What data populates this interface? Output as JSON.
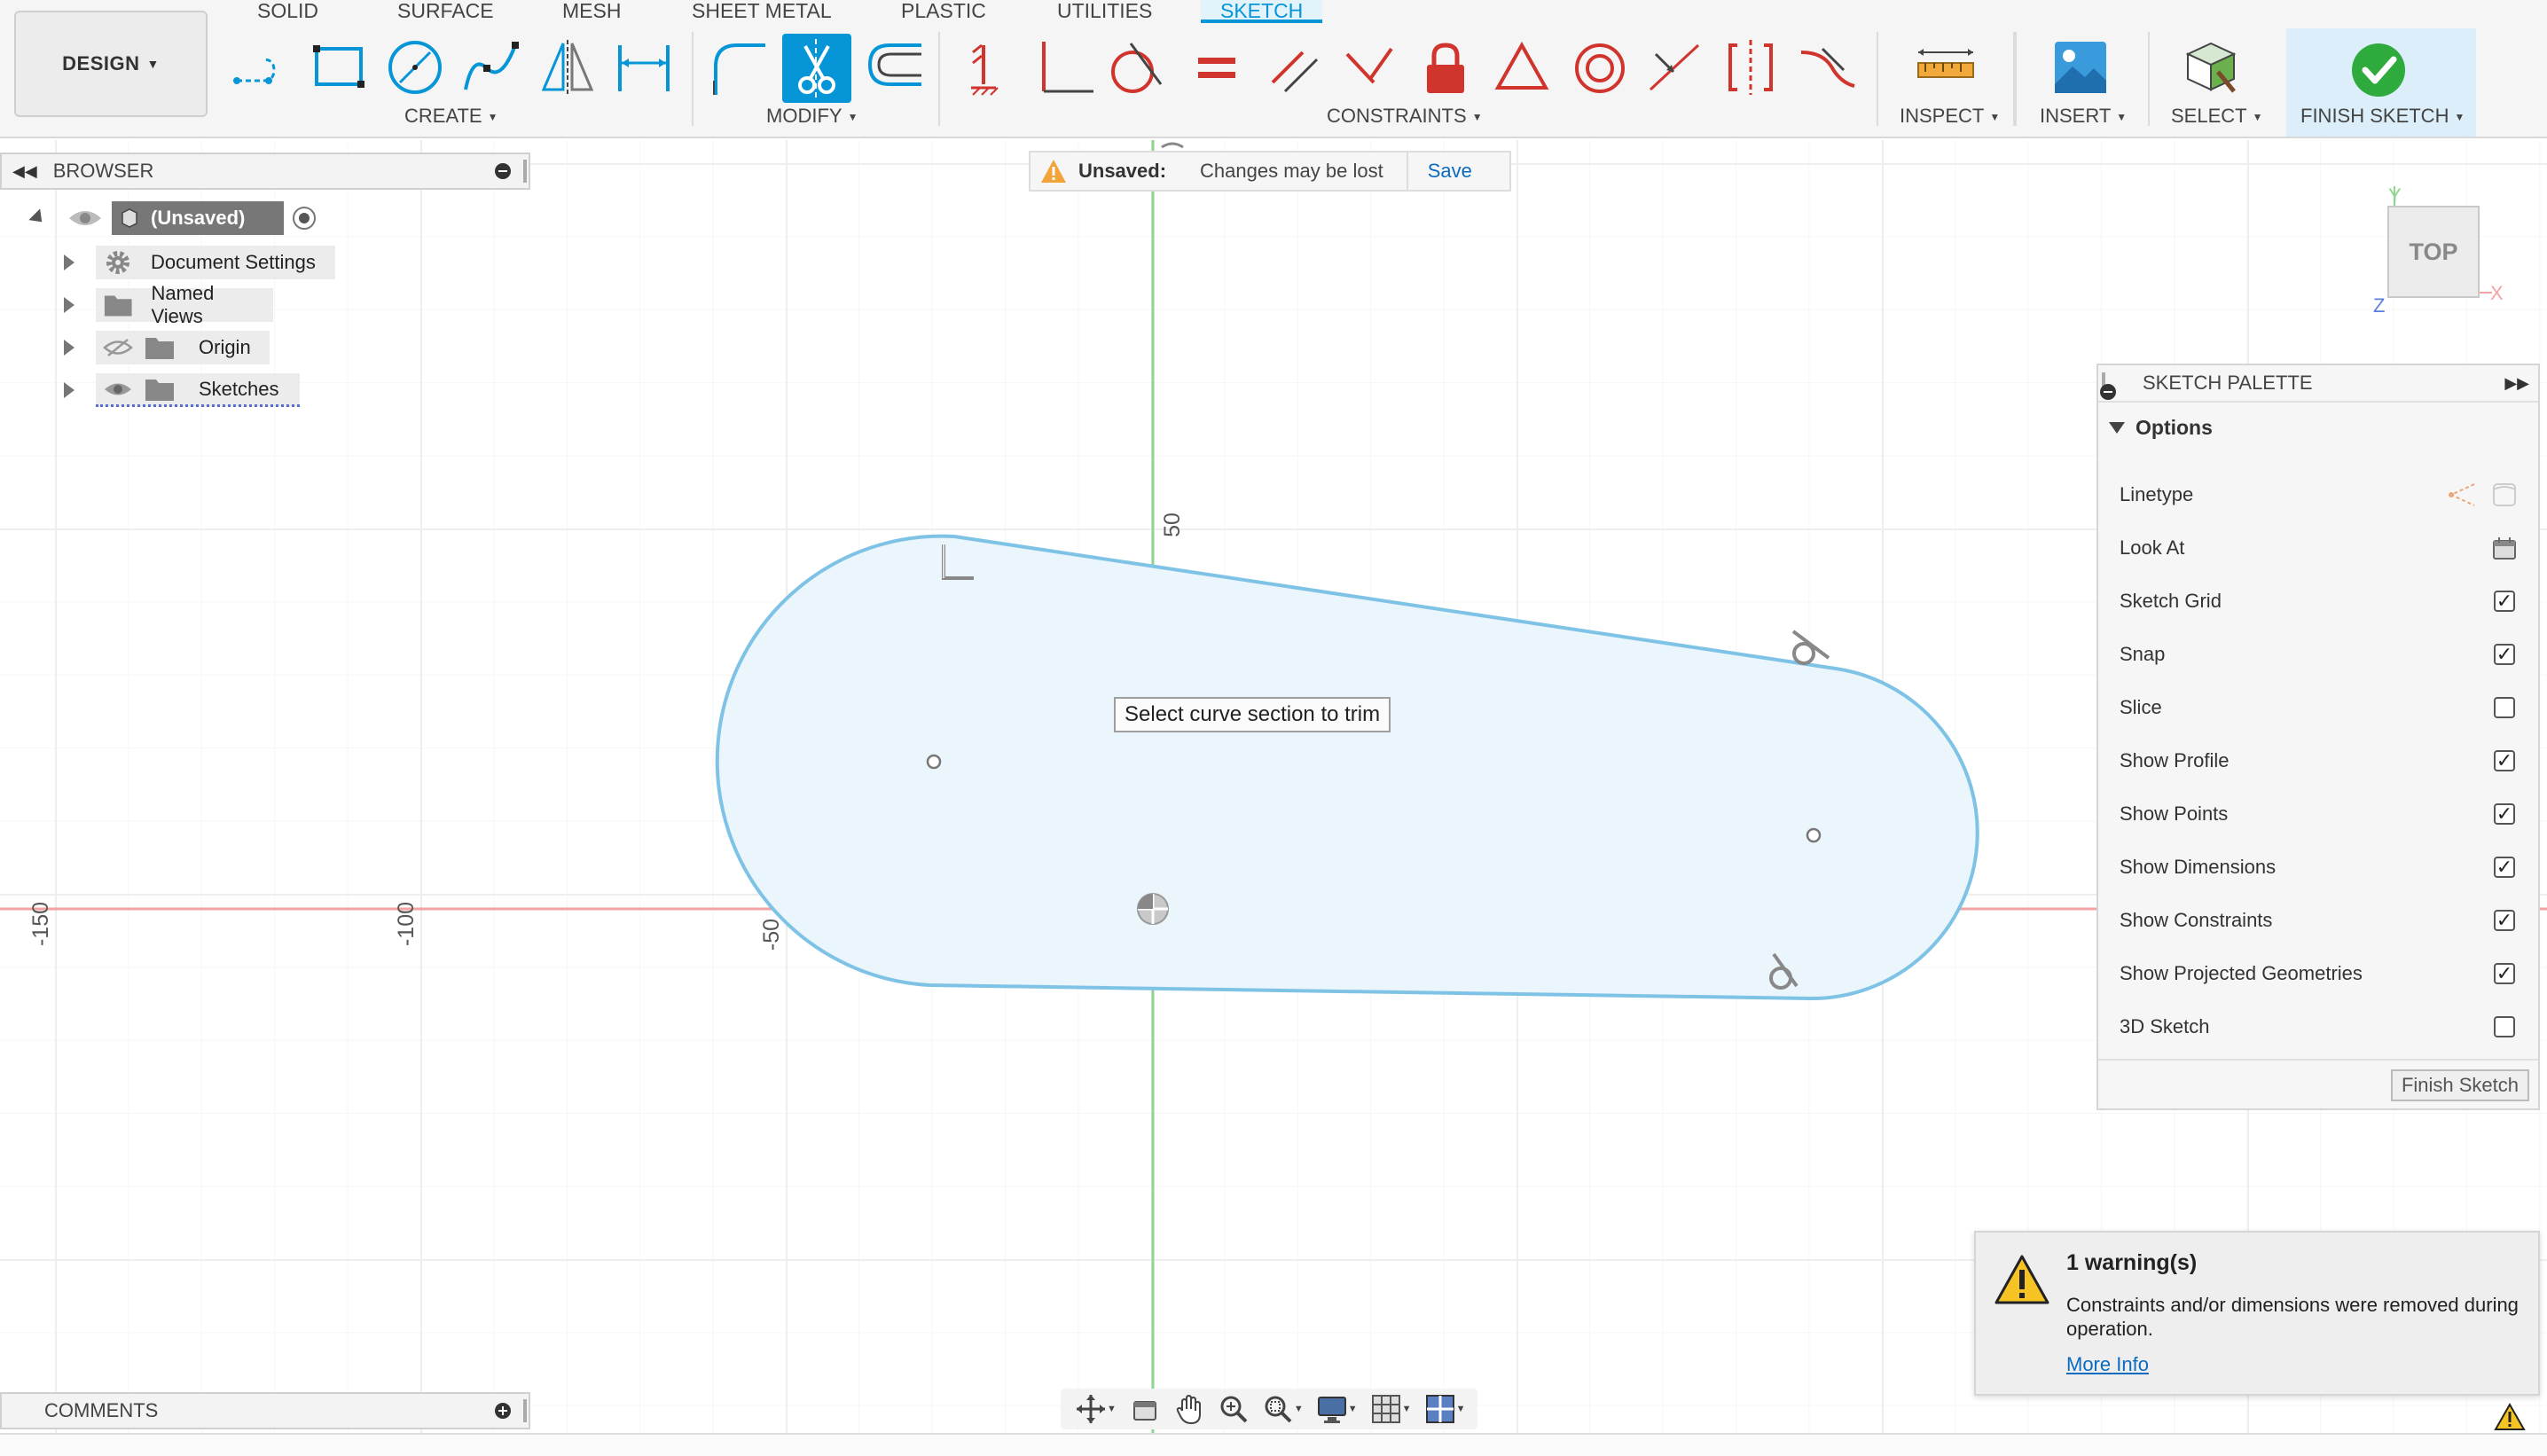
{
  "workspace": {
    "label": "DESIGN"
  },
  "tabs": [
    {
      "label": "SOLID",
      "active": false
    },
    {
      "label": "SURFACE",
      "active": false
    },
    {
      "label": "MESH",
      "active": false
    },
    {
      "label": "SHEET METAL",
      "active": false
    },
    {
      "label": "PLASTIC",
      "active": false
    },
    {
      "label": "UTILITIES",
      "active": false
    },
    {
      "label": "SKETCH",
      "active": true
    }
  ],
  "toolbar_groups": {
    "create": "CREATE",
    "modify": "MODIFY",
    "constraints": "CONSTRAINTS",
    "inspect": "INSPECT",
    "insert": "INSERT",
    "select": "SELECT",
    "finish": "FINISH SKETCH"
  },
  "tools": {
    "create": [
      "line-icon",
      "rectangle-icon",
      "circle-icon",
      "spline-icon",
      "mirror-icon",
      "dimension-icon"
    ],
    "modify": [
      "fillet-icon",
      "trim-icon",
      "offset-icon"
    ],
    "constraints": [
      "fix-icon",
      "perpendicular-icon",
      "tangent-icon",
      "equal-icon",
      "parallel-icon",
      "collinear-icon",
      "lock-icon",
      "triangle-icon",
      "concentric-icon",
      "coincident-icon",
      "midpoint-icon",
      "symmetry-icon"
    ]
  },
  "browser": {
    "title": "BROWSER",
    "root": "(Unsaved)",
    "items": [
      {
        "label": "Document Settings",
        "icon": "gear-icon"
      },
      {
        "label": "Named Views",
        "icon": "folder-icon"
      },
      {
        "label": "Origin",
        "icon": "folder-icon"
      },
      {
        "label": "Sketches",
        "icon": "folder-icon"
      }
    ]
  },
  "unsaved": {
    "label": "Unsaved:",
    "message": "Changes may be lost",
    "save_label": "Save"
  },
  "viewcube": {
    "face": "TOP",
    "axis_y": "Y",
    "axis_x": "X",
    "axis_z": "Z"
  },
  "canvas": {
    "tooltip": "Select curve section to trim",
    "ruler_labels": [
      "-150",
      "-100",
      "-50",
      "50"
    ]
  },
  "palette": {
    "title": "SKETCH PALETTE",
    "section": "Options",
    "options": [
      {
        "label": "Linetype",
        "type": "icons"
      },
      {
        "label": "Look At",
        "type": "icon"
      },
      {
        "label": "Sketch Grid",
        "type": "checkbox",
        "checked": true
      },
      {
        "label": "Snap",
        "type": "checkbox",
        "checked": true
      },
      {
        "label": "Slice",
        "type": "checkbox",
        "checked": false
      },
      {
        "label": "Show Profile",
        "type": "checkbox",
        "checked": true
      },
      {
        "label": "Show Points",
        "type": "checkbox",
        "checked": true
      },
      {
        "label": "Show Dimensions",
        "type": "checkbox",
        "checked": true
      },
      {
        "label": "Show Constraints",
        "type": "checkbox",
        "checked": true
      },
      {
        "label": "Show Projected Geometries",
        "type": "checkbox",
        "checked": true
      },
      {
        "label": "3D Sketch",
        "type": "checkbox",
        "checked": false
      }
    ],
    "finish_label": "Finish Sketch"
  },
  "warning": {
    "title": "1 warning(s)",
    "message": "Constraints and/or dimensions were removed during operation.",
    "link": "More Info"
  },
  "comments": {
    "title": "COMMENTS"
  },
  "colors": {
    "accent": "#0696d7",
    "sketch_line": "#7ec3e6",
    "profile_fill": "#eaf5fc",
    "x_axis": "#f3a3a3",
    "y_axis": "#8fd48f",
    "constraint_red": "#d0342c"
  }
}
